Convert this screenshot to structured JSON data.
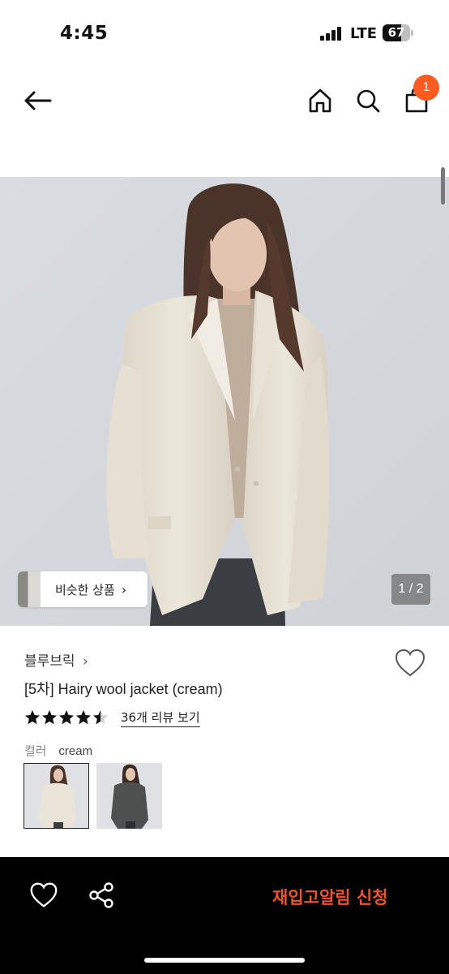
{
  "status_bar": {
    "time": "4:45",
    "network": "LTE",
    "battery": "67",
    "battery_level": 0.67
  },
  "top_nav": {
    "back_icon": "arrow-left-icon",
    "home_icon": "home-icon",
    "search_icon": "search-icon",
    "cart_icon": "shopping-bag-icon",
    "cart_count": "1",
    "badge_color": "#ff5a1f"
  },
  "gallery": {
    "similar_label": "비슷한 상품",
    "page_indicator": "1 / 2"
  },
  "product": {
    "brand": "블루브릭",
    "name": "[5차] Hairy wool jacket (cream)",
    "rating": 4.5,
    "review_link": "36개 리뷰 보기",
    "color_label": "컬러",
    "color_value": "cream",
    "swatches": [
      "cream",
      "charcoal"
    ]
  },
  "bottom_bar": {
    "restock_label": "재입고알림 신청",
    "accent_color": "#f0522e",
    "heart_icon": "heart-outline-icon",
    "share_icon": "share-icon"
  }
}
